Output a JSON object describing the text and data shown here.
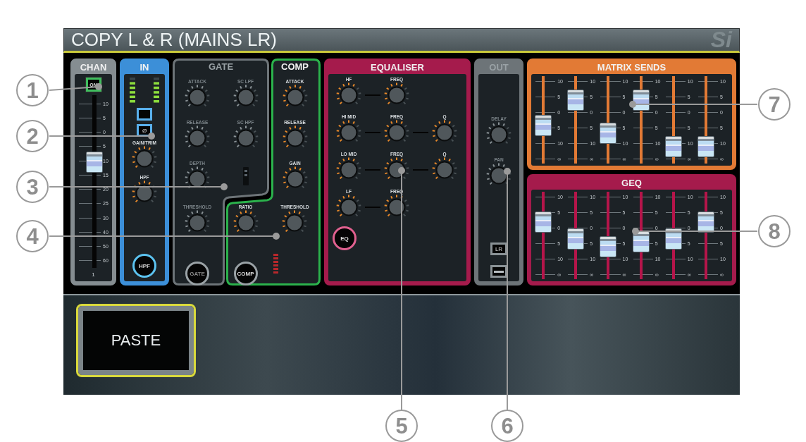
{
  "title": "COPY L & R (MAINS LR)",
  "logo": "Si",
  "chan": {
    "header": "CHAN",
    "on_button": "ON",
    "on": true,
    "fader": {
      "level": 0.63,
      "scale": [
        "10",
        "5",
        "0",
        "5",
        "10",
        "15",
        "20",
        "25",
        "30",
        "40",
        "50",
        "60"
      ]
    },
    "channel_number": "1"
  },
  "input": {
    "header": "IN",
    "active": true,
    "meters": [
      {
        "level": 0.83
      },
      {
        "level": 0.83
      }
    ],
    "polarity_button": "Ø",
    "knobs": [
      {
        "label": "GAIN/TRIM"
      },
      {
        "label": "HPF"
      }
    ],
    "hpf_button": "HPF"
  },
  "gate": {
    "header": "GATE",
    "active": false,
    "knobs": [
      {
        "label": "ATTACK"
      },
      {
        "label": "SC LPF"
      },
      {
        "label": "RELEASE"
      },
      {
        "label": "SC HPF"
      },
      {
        "label": "DEPTH"
      },
      {
        "label": "THRESHOLD"
      }
    ],
    "button": "GATE"
  },
  "comp": {
    "header": "COMP",
    "active": true,
    "knobs": [
      {
        "label": "ATTACK"
      },
      {
        "label": "RELEASE"
      },
      {
        "label": "GAIN"
      },
      {
        "label": "RATIO"
      },
      {
        "label": "THRESHOLD"
      }
    ],
    "button": "COMP"
  },
  "eq": {
    "header": "EQUALISER",
    "active": true,
    "bands": [
      {
        "knobs": [
          {
            "label": "HF"
          },
          {
            "label": "FREQ"
          }
        ]
      },
      {
        "knobs": [
          {
            "label": "HI MID"
          },
          {
            "label": "FREQ"
          },
          {
            "label": "Q"
          }
        ]
      },
      {
        "knobs": [
          {
            "label": "LO MID"
          },
          {
            "label": "FREQ"
          },
          {
            "label": "Q"
          }
        ]
      },
      {
        "knobs": [
          {
            "label": "LF"
          },
          {
            "label": "FREQ"
          }
        ]
      }
    ],
    "button": "EQ"
  },
  "out": {
    "header": "OUT",
    "active": false,
    "knobs": [
      {
        "label": "DELAY"
      },
      {
        "label": "PAN"
      }
    ],
    "lr_button": "LR"
  },
  "matrix": {
    "header": "MATRIX SENDS",
    "faders": [
      {
        "level": 0.42,
        "scale": [
          "10",
          "5",
          "0",
          "5",
          "10",
          "∞"
        ]
      },
      {
        "level": 0.8,
        "scale": [
          "10",
          "5",
          "0",
          "5",
          "10",
          "∞"
        ]
      },
      {
        "level": 0.3,
        "scale": [
          "10",
          "5",
          "0",
          "5",
          "10",
          "∞"
        ]
      },
      {
        "level": 0.8,
        "scale": [
          "10",
          "5",
          "0",
          "5",
          "10",
          "∞"
        ]
      },
      {
        "level": 0.1,
        "scale": [
          "10",
          "5",
          "0",
          "5",
          "10",
          "∞"
        ]
      },
      {
        "level": 0.1,
        "scale": [
          "10",
          "5",
          "0",
          "5",
          "10",
          "∞"
        ]
      }
    ]
  },
  "geq": {
    "header": "GEQ",
    "faders": [
      {
        "level": 0.7,
        "scale": [
          "10",
          "5",
          "0",
          "5",
          "10",
          "∞"
        ]
      },
      {
        "level": 0.45,
        "scale": [
          "10",
          "5",
          "0",
          "5",
          "10",
          "∞"
        ]
      },
      {
        "level": 0.33,
        "scale": [
          "10",
          "5",
          "0",
          "5",
          "10",
          "∞"
        ]
      },
      {
        "level": 0.4,
        "scale": [
          "10",
          "5",
          "0",
          "5",
          "10",
          "∞"
        ]
      },
      {
        "level": 0.45,
        "scale": [
          "10",
          "5",
          "0",
          "5",
          "10",
          "∞"
        ]
      },
      {
        "level": 0.7,
        "scale": [
          "10",
          "5",
          "0",
          "5",
          "10",
          "∞"
        ]
      }
    ]
  },
  "paste_button": "PASTE",
  "callouts": [
    "1",
    "2",
    "3",
    "4",
    "5",
    "6",
    "7",
    "8"
  ]
}
